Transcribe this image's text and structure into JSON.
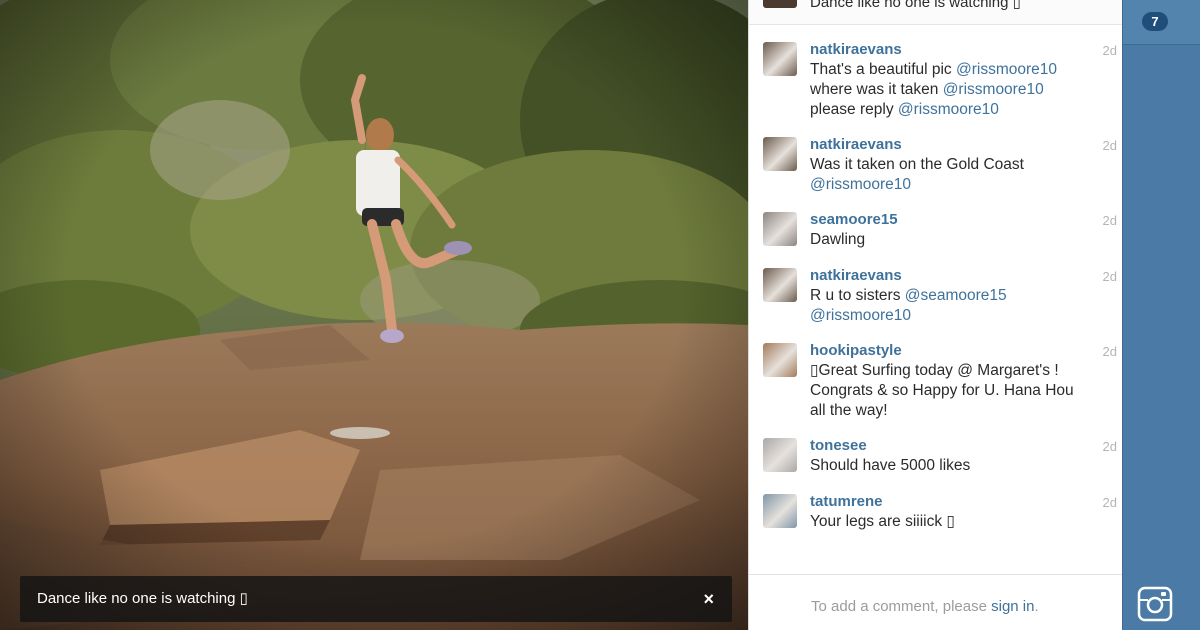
{
  "photo": {
    "caption": "Dance like no one is watching ▯",
    "close_label": "×"
  },
  "top_comment": {
    "text": "Dance like no one is watching ▯"
  },
  "comments": [
    {
      "username": "natkiraevans",
      "time": "2d",
      "lines": [
        [
          {
            "t": "That's a beautiful pic "
          },
          {
            "m": "@rissmoore10"
          }
        ],
        [
          {
            "t": "where was it taken "
          },
          {
            "m": "@rissmoore10"
          }
        ],
        [
          {
            "t": "please reply "
          },
          {
            "m": "@rissmoore10"
          }
        ]
      ]
    },
    {
      "username": "natkiraevans",
      "time": "2d",
      "lines": [
        [
          {
            "t": "Was it taken on the Gold Coast"
          }
        ],
        [
          {
            "m": "@rissmoore10"
          }
        ]
      ]
    },
    {
      "username": "seamoore15",
      "time": "2d",
      "lines": [
        [
          {
            "t": "Dawling"
          }
        ]
      ]
    },
    {
      "username": "natkiraevans",
      "time": "2d",
      "lines": [
        [
          {
            "t": "R u to sisters "
          },
          {
            "m": "@seamoore15"
          }
        ],
        [
          {
            "m": "@rissmoore10"
          }
        ]
      ]
    },
    {
      "username": "hookipastyle",
      "time": "2d",
      "lines": [
        [
          {
            "t": "▯Great Surfing today @ Margaret's !"
          }
        ],
        [
          {
            "t": "Congrats & so Happy for U. Hana Hou"
          }
        ],
        [
          {
            "t": "all the way!"
          }
        ]
      ]
    },
    {
      "username": "tonesee",
      "time": "2d",
      "lines": [
        [
          {
            "t": "Should have 5000 likes"
          }
        ]
      ]
    },
    {
      "username": "tatumrene",
      "time": "2d",
      "lines": [
        [
          {
            "t": "Your legs are siiiick ▯"
          }
        ]
      ]
    }
  ],
  "add_comment": {
    "prompt": "To add a comment, please ",
    "signin_label": "sign in",
    "suffix": "."
  },
  "rail": {
    "badge_count": "7",
    "camera_icon": "instagram-camera-icon"
  },
  "colors": {
    "link": "#3f729b",
    "rail": "#4a7aa5",
    "badge": "#1e4e79"
  }
}
